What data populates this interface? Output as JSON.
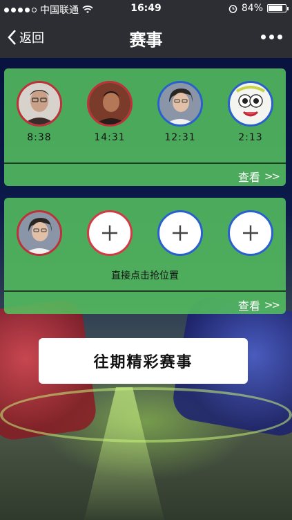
{
  "status": {
    "carrier": "中国联通",
    "time": "16:49",
    "battery": "84%",
    "battery_level": 0.84,
    "signal_bars": 4
  },
  "nav": {
    "back_label": "返回",
    "title": "赛事"
  },
  "panel1": {
    "players": [
      {
        "time": "8:38",
        "ring": "red",
        "icon": "avatar-man-glasses"
      },
      {
        "time": "14:31",
        "ring": "red",
        "icon": "avatar-man-dark"
      },
      {
        "time": "12:31",
        "ring": "blue",
        "icon": "avatar-woman-glasses"
      },
      {
        "time": "2:13",
        "ring": "blue",
        "icon": "avatar-cartoon"
      }
    ],
    "view_label": "查看",
    "view_icon": ">>"
  },
  "panel2": {
    "hint": "直接点击抢位置",
    "view_label": "查看",
    "view_icon": ">>"
  },
  "history_button": "往期精彩赛事",
  "colors": {
    "panel": "#54be5f",
    "red_team": "#c0303a",
    "blue_team": "#2a5fd0",
    "nav_bg": "#2c2e33"
  }
}
